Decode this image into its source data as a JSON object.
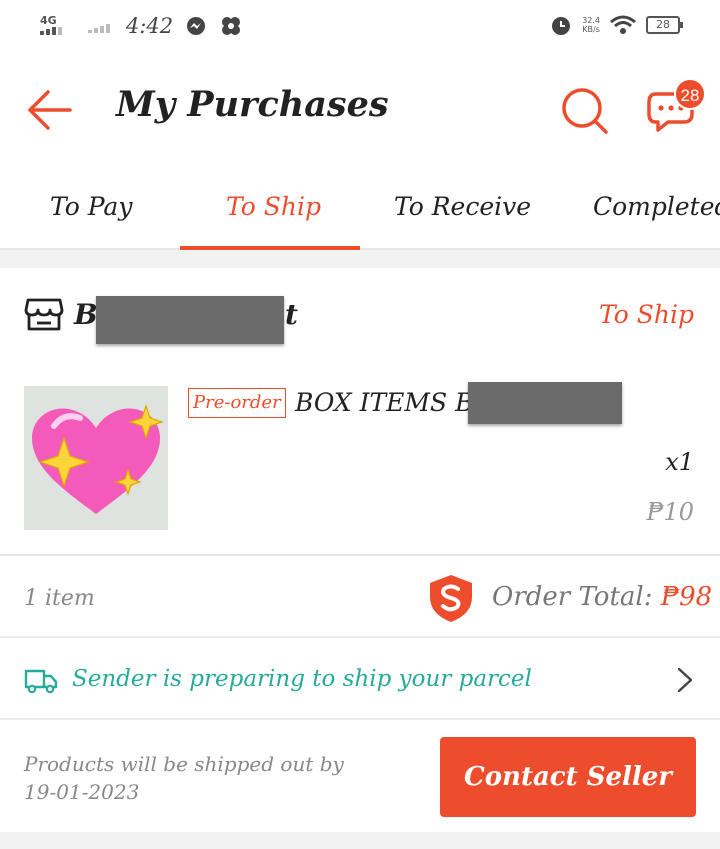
{
  "status_bar": {
    "network": "4G",
    "time": "4:42",
    "speed_value": "32.4",
    "speed_unit": "KB/s",
    "battery": "28"
  },
  "header": {
    "title": "My Purchases",
    "chat_badge": "28"
  },
  "tabs": [
    {
      "label": "To Pay",
      "active": false
    },
    {
      "label": "To Ship",
      "active": true
    },
    {
      "label": "To Receive",
      "active": false
    },
    {
      "label": "Completed",
      "active": false
    }
  ],
  "order": {
    "shop_name_start": "B",
    "shop_name_end": "t",
    "status": "To Ship",
    "product": {
      "tag": "Pre-order",
      "name": "BOX ITEMS BY",
      "quantity": "x1",
      "price": "₱10"
    },
    "item_count": "1 item",
    "total_label": "Order Total:",
    "total_value": "₱98",
    "shipping_status": "Sender is preparing to ship your parcel",
    "ship_by_line1": "Products will be shipped out by",
    "ship_by_line2": "19-01-2023",
    "contact_button": "Contact Seller"
  },
  "colors": {
    "accent": "#ee4d2d",
    "teal": "#26aa99",
    "muted": "#888888"
  },
  "icons": [
    "back-arrow-icon",
    "search-icon",
    "chat-icon",
    "shop-icon",
    "shield-icon",
    "truck-icon",
    "chevron-right-icon",
    "messenger-icon",
    "pinwheel-icon",
    "alarm-icon",
    "wifi-icon"
  ]
}
